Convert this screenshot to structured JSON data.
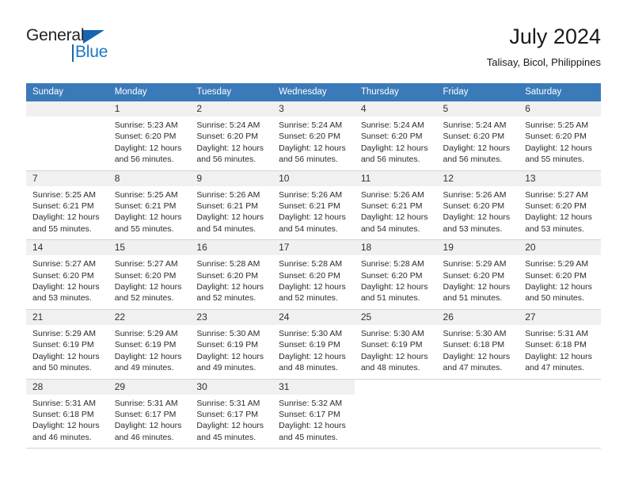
{
  "logo": {
    "primary_text": "General",
    "secondary_text": "Blue",
    "accent_color": "#1b78c8",
    "triangle_icon": "triangle-icon"
  },
  "header": {
    "title": "July 2024",
    "subtitle": "Talisay, Bicol, Philippines",
    "header_bg_color": "#3a7ab8"
  },
  "weekdays": [
    "Sunday",
    "Monday",
    "Tuesday",
    "Wednesday",
    "Thursday",
    "Friday",
    "Saturday"
  ],
  "labels": {
    "sunrise_prefix": "Sunrise:",
    "sunset_prefix": "Sunset:",
    "daylight_prefix": "Daylight:"
  },
  "weeks": [
    [
      {
        "day": "",
        "sunrise": "",
        "sunset": "",
        "daylight": "",
        "empty": true
      },
      {
        "day": "1",
        "sunrise": "Sunrise: 5:23 AM",
        "sunset": "Sunset: 6:20 PM",
        "daylight": "Daylight: 12 hours and 56 minutes."
      },
      {
        "day": "2",
        "sunrise": "Sunrise: 5:24 AM",
        "sunset": "Sunset: 6:20 PM",
        "daylight": "Daylight: 12 hours and 56 minutes."
      },
      {
        "day": "3",
        "sunrise": "Sunrise: 5:24 AM",
        "sunset": "Sunset: 6:20 PM",
        "daylight": "Daylight: 12 hours and 56 minutes."
      },
      {
        "day": "4",
        "sunrise": "Sunrise: 5:24 AM",
        "sunset": "Sunset: 6:20 PM",
        "daylight": "Daylight: 12 hours and 56 minutes."
      },
      {
        "day": "5",
        "sunrise": "Sunrise: 5:24 AM",
        "sunset": "Sunset: 6:20 PM",
        "daylight": "Daylight: 12 hours and 56 minutes."
      },
      {
        "day": "6",
        "sunrise": "Sunrise: 5:25 AM",
        "sunset": "Sunset: 6:20 PM",
        "daylight": "Daylight: 12 hours and 55 minutes."
      }
    ],
    [
      {
        "day": "7",
        "sunrise": "Sunrise: 5:25 AM",
        "sunset": "Sunset: 6:21 PM",
        "daylight": "Daylight: 12 hours and 55 minutes."
      },
      {
        "day": "8",
        "sunrise": "Sunrise: 5:25 AM",
        "sunset": "Sunset: 6:21 PM",
        "daylight": "Daylight: 12 hours and 55 minutes."
      },
      {
        "day": "9",
        "sunrise": "Sunrise: 5:26 AM",
        "sunset": "Sunset: 6:21 PM",
        "daylight": "Daylight: 12 hours and 54 minutes."
      },
      {
        "day": "10",
        "sunrise": "Sunrise: 5:26 AM",
        "sunset": "Sunset: 6:21 PM",
        "daylight": "Daylight: 12 hours and 54 minutes."
      },
      {
        "day": "11",
        "sunrise": "Sunrise: 5:26 AM",
        "sunset": "Sunset: 6:21 PM",
        "daylight": "Daylight: 12 hours and 54 minutes."
      },
      {
        "day": "12",
        "sunrise": "Sunrise: 5:26 AM",
        "sunset": "Sunset: 6:20 PM",
        "daylight": "Daylight: 12 hours and 53 minutes."
      },
      {
        "day": "13",
        "sunrise": "Sunrise: 5:27 AM",
        "sunset": "Sunset: 6:20 PM",
        "daylight": "Daylight: 12 hours and 53 minutes."
      }
    ],
    [
      {
        "day": "14",
        "sunrise": "Sunrise: 5:27 AM",
        "sunset": "Sunset: 6:20 PM",
        "daylight": "Daylight: 12 hours and 53 minutes."
      },
      {
        "day": "15",
        "sunrise": "Sunrise: 5:27 AM",
        "sunset": "Sunset: 6:20 PM",
        "daylight": "Daylight: 12 hours and 52 minutes."
      },
      {
        "day": "16",
        "sunrise": "Sunrise: 5:28 AM",
        "sunset": "Sunset: 6:20 PM",
        "daylight": "Daylight: 12 hours and 52 minutes."
      },
      {
        "day": "17",
        "sunrise": "Sunrise: 5:28 AM",
        "sunset": "Sunset: 6:20 PM",
        "daylight": "Daylight: 12 hours and 52 minutes."
      },
      {
        "day": "18",
        "sunrise": "Sunrise: 5:28 AM",
        "sunset": "Sunset: 6:20 PM",
        "daylight": "Daylight: 12 hours and 51 minutes."
      },
      {
        "day": "19",
        "sunrise": "Sunrise: 5:29 AM",
        "sunset": "Sunset: 6:20 PM",
        "daylight": "Daylight: 12 hours and 51 minutes."
      },
      {
        "day": "20",
        "sunrise": "Sunrise: 5:29 AM",
        "sunset": "Sunset: 6:20 PM",
        "daylight": "Daylight: 12 hours and 50 minutes."
      }
    ],
    [
      {
        "day": "21",
        "sunrise": "Sunrise: 5:29 AM",
        "sunset": "Sunset: 6:19 PM",
        "daylight": "Daylight: 12 hours and 50 minutes."
      },
      {
        "day": "22",
        "sunrise": "Sunrise: 5:29 AM",
        "sunset": "Sunset: 6:19 PM",
        "daylight": "Daylight: 12 hours and 49 minutes."
      },
      {
        "day": "23",
        "sunrise": "Sunrise: 5:30 AM",
        "sunset": "Sunset: 6:19 PM",
        "daylight": "Daylight: 12 hours and 49 minutes."
      },
      {
        "day": "24",
        "sunrise": "Sunrise: 5:30 AM",
        "sunset": "Sunset: 6:19 PM",
        "daylight": "Daylight: 12 hours and 48 minutes."
      },
      {
        "day": "25",
        "sunrise": "Sunrise: 5:30 AM",
        "sunset": "Sunset: 6:19 PM",
        "daylight": "Daylight: 12 hours and 48 minutes."
      },
      {
        "day": "26",
        "sunrise": "Sunrise: 5:30 AM",
        "sunset": "Sunset: 6:18 PM",
        "daylight": "Daylight: 12 hours and 47 minutes."
      },
      {
        "day": "27",
        "sunrise": "Sunrise: 5:31 AM",
        "sunset": "Sunset: 6:18 PM",
        "daylight": "Daylight: 12 hours and 47 minutes."
      }
    ],
    [
      {
        "day": "28",
        "sunrise": "Sunrise: 5:31 AM",
        "sunset": "Sunset: 6:18 PM",
        "daylight": "Daylight: 12 hours and 46 minutes."
      },
      {
        "day": "29",
        "sunrise": "Sunrise: 5:31 AM",
        "sunset": "Sunset: 6:17 PM",
        "daylight": "Daylight: 12 hours and 46 minutes."
      },
      {
        "day": "30",
        "sunrise": "Sunrise: 5:31 AM",
        "sunset": "Sunset: 6:17 PM",
        "daylight": "Daylight: 12 hours and 45 minutes."
      },
      {
        "day": "31",
        "sunrise": "Sunrise: 5:32 AM",
        "sunset": "Sunset: 6:17 PM",
        "daylight": "Daylight: 12 hours and 45 minutes."
      },
      {
        "day": "",
        "sunrise": "",
        "sunset": "",
        "daylight": "",
        "empty": true,
        "blank": true
      },
      {
        "day": "",
        "sunrise": "",
        "sunset": "",
        "daylight": "",
        "empty": true,
        "blank": true
      },
      {
        "day": "",
        "sunrise": "",
        "sunset": "",
        "daylight": "",
        "empty": true,
        "blank": true
      }
    ]
  ]
}
